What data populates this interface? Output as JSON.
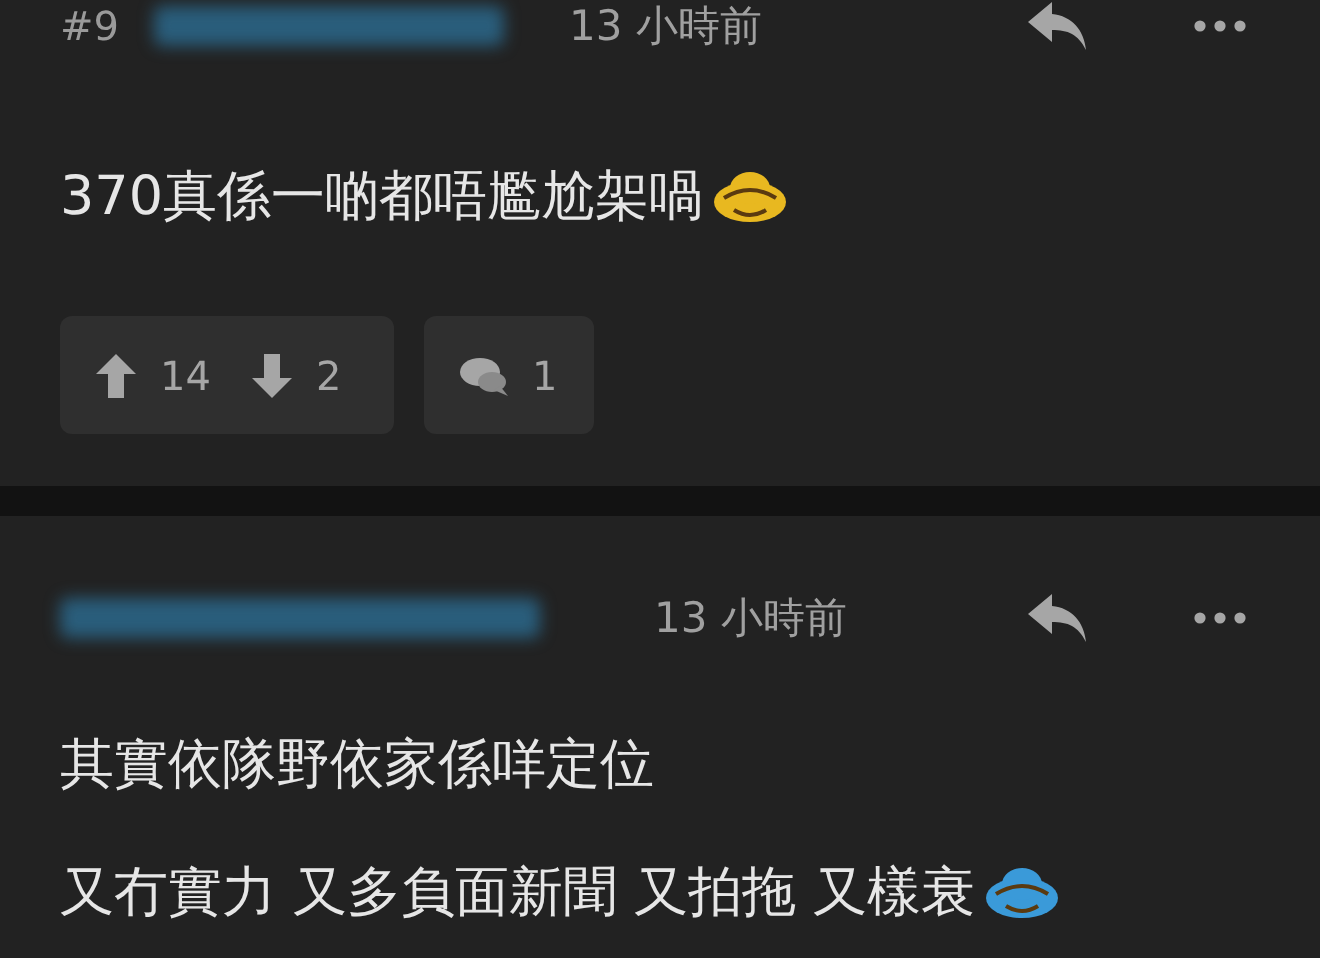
{
  "posts": [
    {
      "floor": "#9",
      "time": "13 小時前",
      "lines": [
        {
          "text": "370真係一啲都唔尷尬架喎",
          "emoji": {
            "color": "#e8b820"
          }
        }
      ],
      "votes": {
        "up": "14",
        "down": "2"
      },
      "comments": "1"
    },
    {
      "time": "13 小時前",
      "lines": [
        {
          "text": "其實依隊野依家係咩定位"
        },
        {
          "text": "又冇實力 又多負面新聞 又拍拖 又樣衰",
          "emoji": {
            "color": "#3a9ad9"
          }
        }
      ]
    }
  ]
}
